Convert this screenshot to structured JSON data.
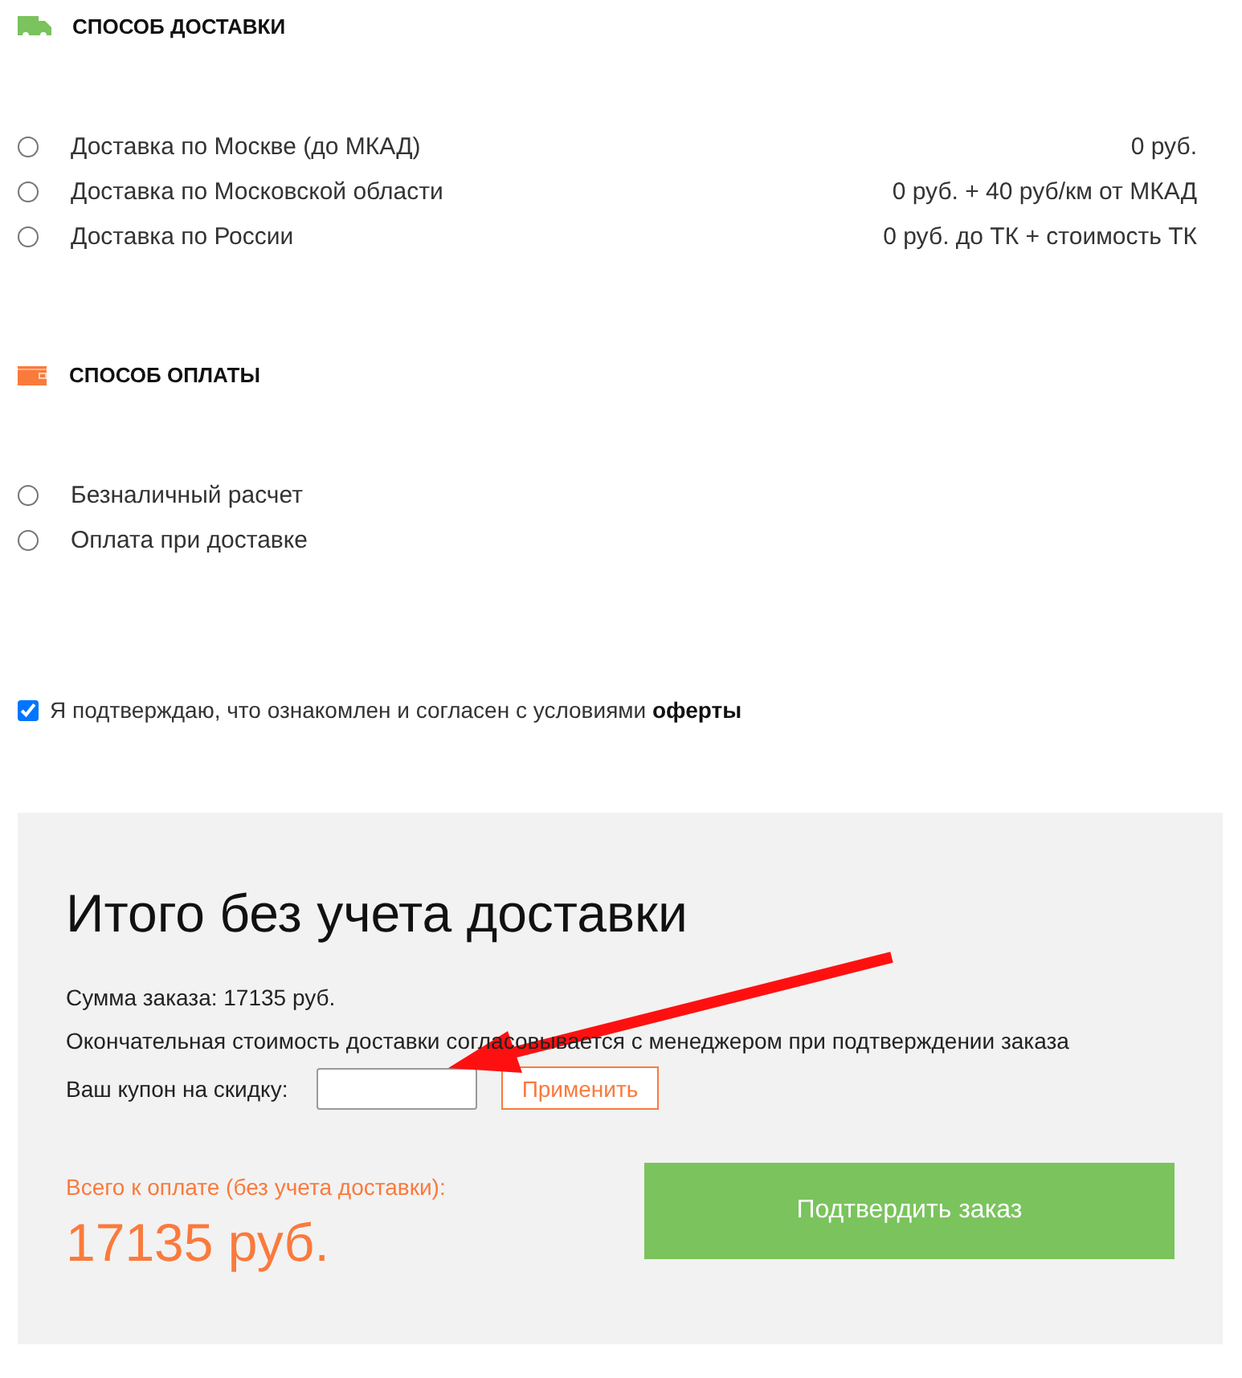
{
  "delivery": {
    "title": "СПОСОБ ДОСТАВКИ",
    "options": [
      {
        "label": "Доставка по Москве (до МКАД)",
        "price": "0 руб.",
        "selected": false
      },
      {
        "label": "Доставка по Московской области",
        "price": "0 руб. + 40 руб/км от МКАД",
        "selected": false
      },
      {
        "label": "Доставка по России",
        "price": "0 руб. до ТК + стоимость ТК",
        "selected": false
      }
    ]
  },
  "payment": {
    "title": "СПОСОБ ОПЛАТЫ",
    "options": [
      {
        "label": "Безналичный расчет",
        "selected": false
      },
      {
        "label": "Оплата при доставке",
        "selected": false
      }
    ]
  },
  "agreement": {
    "text": "Я подтверждаю, что ознакомлен и согласен с условиями **оферты**",
    "checked": true
  },
  "summary": {
    "title": "Итого без учета доставки",
    "order_sum": "Сумма заказа: 17135 руб.",
    "note": "Окончательная стоимость доставки согласовывается с менеджером при подтверждении заказа",
    "coupon": {
      "label": "Ваш купон на скидку:",
      "button": "Применить"
    },
    "total_label": "Всего к оплате (без учета доставки):",
    "total": "17135 руб.",
    "confirm_button": "Подтвердить заказ"
  }
}
